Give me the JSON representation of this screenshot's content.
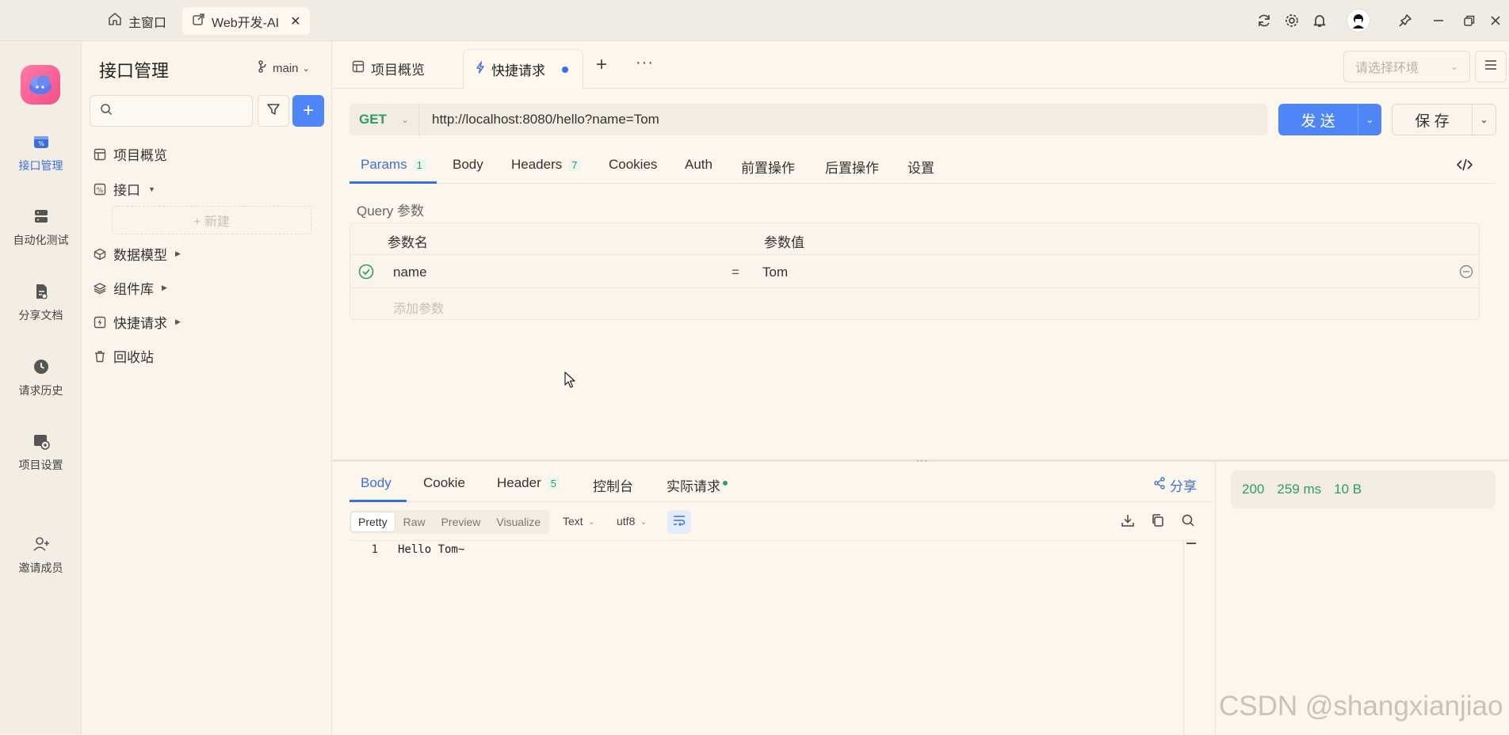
{
  "window": {
    "tabs": [
      {
        "label": "主窗口",
        "icon": "home-icon"
      },
      {
        "label": "Web开发-AI",
        "icon": "external-window-icon"
      }
    ]
  },
  "rail": {
    "items": [
      {
        "label": "接口管理",
        "icon": "api-icon",
        "active": true
      },
      {
        "label": "自动化测试",
        "icon": "server-icon"
      },
      {
        "label": "分享文档",
        "icon": "document-icon"
      },
      {
        "label": "请求历史",
        "icon": "history-icon"
      },
      {
        "label": "项目设置",
        "icon": "project-settings-icon"
      },
      {
        "label": "邀请成员",
        "icon": "add-user-icon"
      }
    ]
  },
  "tree": {
    "title": "接口管理",
    "branch": "main",
    "search_placeholder": "",
    "new_label": "+ 新建",
    "items": [
      {
        "label": "项目概览",
        "icon": "overview-icon"
      },
      {
        "label": "接口",
        "icon": "percent-icon"
      },
      {
        "label": "数据模型",
        "icon": "cube-icon"
      },
      {
        "label": "组件库",
        "icon": "layers-icon"
      },
      {
        "label": "快捷请求",
        "icon": "lightning-icon"
      },
      {
        "label": "回收站",
        "icon": "trash-icon"
      }
    ]
  },
  "main": {
    "tabs": [
      {
        "label": "项目概览",
        "icon": "overview-icon"
      },
      {
        "label": "快捷请求",
        "icon": "lightning-icon",
        "active": true
      }
    ],
    "env_placeholder": "请选择环境",
    "request": {
      "method": "GET",
      "url": "http://localhost:8080/hello?name=Tom",
      "send_label": "发 送",
      "save_label": "保 存"
    },
    "request_tabs": [
      {
        "label": "Params",
        "count": "1",
        "active": true
      },
      {
        "label": "Body",
        "count": ""
      },
      {
        "label": "Headers",
        "count": "7"
      },
      {
        "label": "Cookies",
        "count": ""
      },
      {
        "label": "Auth",
        "count": ""
      },
      {
        "label": "前置操作",
        "count": ""
      },
      {
        "label": "后置操作",
        "count": ""
      },
      {
        "label": "设置",
        "count": ""
      }
    ],
    "query": {
      "section_label": "Query 参数",
      "col_name": "参数名",
      "col_value": "参数值",
      "rows": [
        {
          "name": "name",
          "eq": "=",
          "value": "Tom",
          "enabled": true
        }
      ],
      "add_placeholder": "添加参数"
    }
  },
  "response": {
    "tabs": [
      {
        "label": "Body",
        "count": "",
        "active": true
      },
      {
        "label": "Cookie",
        "count": ""
      },
      {
        "label": "Header",
        "count": "5"
      },
      {
        "label": "控制台",
        "count": ""
      },
      {
        "label": "实际请求",
        "count": ""
      }
    ],
    "share_label": "分享",
    "formats": [
      "Pretty",
      "Raw",
      "Preview",
      "Visualize"
    ],
    "type_select": "Text",
    "encoding_select": "utf8",
    "lines": [
      {
        "no": "1",
        "text": "Hello Tom~"
      }
    ],
    "status": {
      "code": "200",
      "time": "259 ms",
      "size": "10 B"
    }
  },
  "watermark": "CSDN @shangxianjiao",
  "colors": {
    "accent": "#3b6fe0",
    "send": "#4f86f7",
    "method": "#2e9d6a",
    "status": "#2e9d6a",
    "bg": "#fdf6ec"
  }
}
